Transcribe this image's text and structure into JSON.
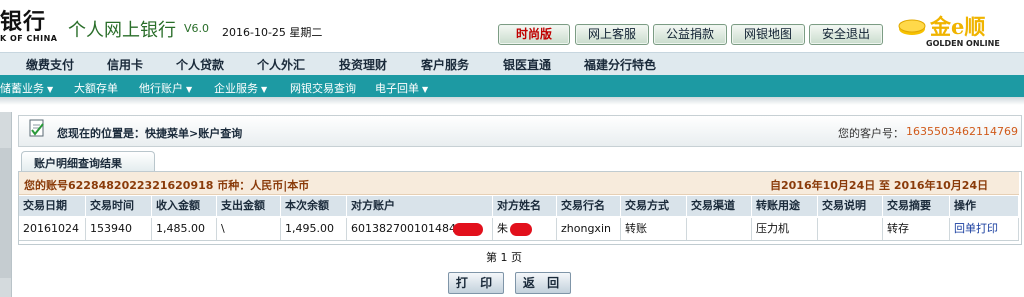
{
  "header": {
    "bank_name": "银行",
    "bank_name_en": "K OF CHINA",
    "app_title": "个人网上银行",
    "version": "V6.0",
    "date": "2016-10-25 星期二",
    "buttons": [
      "时尚版",
      "网上客服",
      "公益捐款",
      "网银地图",
      "安全退出"
    ],
    "brand": {
      "name": "金e顺",
      "sub": "GOLDEN ONLINE",
      "color": "#f0b400"
    }
  },
  "nav": {
    "items": [
      "缴费支付",
      "信用卡",
      "个人贷款",
      "个人外汇",
      "投资理财",
      "客户服务",
      "银医直通",
      "福建分行特色"
    ]
  },
  "subnav": {
    "items": [
      "储蓄业务",
      "大额存单",
      "他行账户",
      "企业服务",
      "网银交易查询",
      "电子回单"
    ],
    "has_dropdown": [
      true,
      false,
      true,
      true,
      false,
      true
    ]
  },
  "breadcrumb": {
    "text": "您现在的位置是：快捷菜单>账户查询",
    "customer_label": "您的客户号：",
    "customer_no": "1635503462114769"
  },
  "result": {
    "tab_label": "账户明细查询结果",
    "account_info": "您的账号6228482022321620918 币种：人民币|本币",
    "date_range": "自2016年10月24日  至  2016年10月24日",
    "columns": [
      "交易日期",
      "交易时间",
      "收入金额",
      "支出金额",
      "本次余额",
      "对方账户",
      "对方姓名",
      "交易行名",
      "交易方式",
      "交易渠道",
      "转账用途",
      "交易说明",
      "交易摘要",
      "操作"
    ],
    "rows": [
      {
        "date": "20161024",
        "time": "153940",
        "income": "1,485.00",
        "expense": "\\",
        "balance": "1,495.00",
        "counter_account": "601382700101484",
        "counter_name": "朱",
        "bank_name": "zhongxin",
        "method": "转账",
        "channel": "",
        "purpose": "压力机",
        "description": "",
        "summary": "转存",
        "action": "回单打印"
      }
    ],
    "page_info": "第 1 页"
  },
  "actions": {
    "print": "打 印",
    "back": "返 回"
  }
}
